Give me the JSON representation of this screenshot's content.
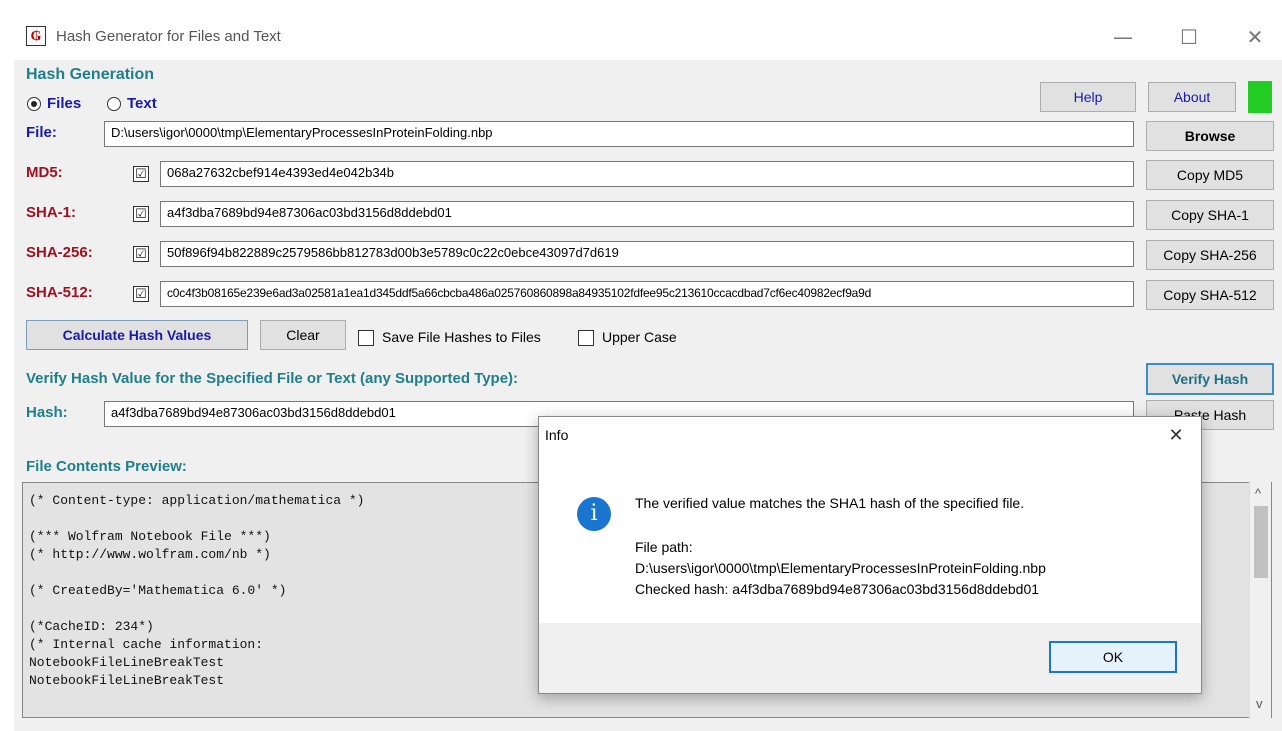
{
  "window": {
    "title": "Hash Generator for Files and Text",
    "minimize_glyph": "—",
    "maximize_glyph": "☐",
    "close_glyph": "✕"
  },
  "generation": {
    "group_title": "Hash Generation",
    "radio_files": "Files",
    "radio_text": "Text",
    "help_label": "Help",
    "about_label": "About",
    "status_color": "#22cc22",
    "file_label": "File:",
    "file_path": "D:\\users\\igor\\0000\\tmp\\ElementaryProcessesInProteinFolding.nbp",
    "browse_label": "Browse"
  },
  "hashes": [
    {
      "label": "MD5:",
      "value": "068a27632cbef914e4393ed4e042b34b",
      "copy": "Copy MD5",
      "checked": "☑"
    },
    {
      "label": "SHA-1:",
      "value": "a4f3dba7689bd94e87306ac03bd3156d8ddebd01",
      "copy": "Copy SHA-1",
      "checked": "☑"
    },
    {
      "label": "SHA-256:",
      "value": "50f896f94b822889c2579586bb812783d00b3e5789c0c22c0ebce43097d7d619",
      "copy": "Copy SHA-256",
      "checked": "☑"
    },
    {
      "label": "SHA-512:",
      "value": "c0c4f3b08165e239e6ad3a02581a1ea1d345ddf5a66cbcba486a025760860898a84935102fdfee95c213610ccacdbad7cf6ec40982ecf9a9d",
      "copy": "Copy SHA-512",
      "checked": "☑"
    }
  ],
  "actions": {
    "calculate_label": "Calculate Hash Values",
    "clear_label": "Clear",
    "save_to_files_label": "Save File Hashes to Files",
    "upper_case_label": "Upper Case"
  },
  "verify": {
    "title": "Verify Hash Value for the Specified File or Text (any Supported Type):",
    "verify_label": "Verify Hash",
    "hash_label": "Hash:",
    "hash_value": "a4f3dba7689bd94e87306ac03bd3156d8ddebd01",
    "paste_label": "Paste Hash"
  },
  "preview": {
    "title": "File Contents Preview:",
    "lines": [
      "(* Content-type: application/mathematica *)",
      "",
      "(*** Wolfram Notebook File ***)",
      "(* http://www.wolfram.com/nb *)",
      "",
      "(* CreatedBy='Mathematica 6.0' *)",
      "",
      "(*CacheID: 234*)",
      "(* Internal cache information:",
      "NotebookFileLineBreakTest",
      "NotebookFileLineBreakTest"
    ],
    "scroll_up": "^",
    "scroll_down": "v"
  },
  "dialog": {
    "title": "Info",
    "close_glyph": "✕",
    "info_glyph": "i",
    "message": "The verified value matches the SHA1 hash of the specified file.",
    "path_label": "File path:",
    "path_value": "D:\\users\\igor\\0000\\tmp\\ElementaryProcessesInProteinFolding.nbp",
    "checked_line": "Checked hash: a4f3dba7689bd94e87306ac03bd3156d8ddebd01",
    "ok_label": "OK",
    "accent": "#1a75cf"
  }
}
